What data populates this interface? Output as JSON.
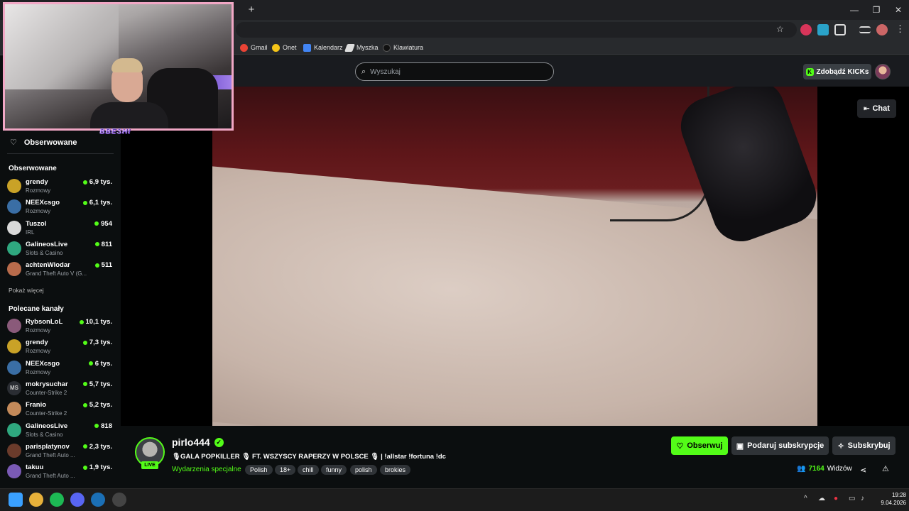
{
  "browser": {
    "new_tab": "+",
    "window_controls": {
      "minimize": "—",
      "restore": "❐",
      "close": "✕"
    },
    "bookmarks": [
      {
        "label": "Gmail",
        "icon": "gmail-icon",
        "color": "#ea4335"
      },
      {
        "label": "Onet",
        "icon": "onet-icon",
        "color": "#f5c518"
      },
      {
        "label": "Kalendarz",
        "icon": "calendar-icon",
        "color": "#4285f4"
      },
      {
        "label": "Myszka",
        "icon": "mouse-icon",
        "color": "#dddddd"
      },
      {
        "label": "Klawiatura",
        "icon": "keyboard-icon",
        "color": "#222222"
      }
    ]
  },
  "header": {
    "search_placeholder": "Wyszukaj",
    "kicks_button": "Zdobądź KICKs"
  },
  "overlay": {
    "logo_text": "BBESHI"
  },
  "sidebar": {
    "followed_header": "Obserwowane",
    "followed_title": "Obserwowane",
    "followed": [
      {
        "name": "grendy",
        "category": "Rozmowy",
        "viewers": "6,9 tys.",
        "color": "#c9a227"
      },
      {
        "name": "NEEXcsgo",
        "category": "Rozmowy",
        "viewers": "6,1 tys.",
        "color": "#3a6ea5"
      },
      {
        "name": "Tuszol",
        "category": "IRL",
        "viewers": "954",
        "color": "#d9d9d9"
      },
      {
        "name": "GalineosLive",
        "category": "Slots & Casino",
        "viewers": "811",
        "color": "#2fa87f"
      },
      {
        "name": "achtenWlodar",
        "category": "Grand Theft Auto V (G...",
        "viewers": "511",
        "color": "#b86b4b"
      }
    ],
    "show_more": "Pokaż więcej",
    "recommended_title": "Polecane kanały",
    "recommended": [
      {
        "name": "RybsonLoL",
        "category": "Rozmowy",
        "viewers": "10,1 tys.",
        "color": "#8a5a7a"
      },
      {
        "name": "grendy",
        "category": "Rozmowy",
        "viewers": "7,3 tys.",
        "color": "#c9a227"
      },
      {
        "name": "NEEXcsgo",
        "category": "Rozmowy",
        "viewers": "6 tys.",
        "color": "#3a6ea5"
      },
      {
        "name": "mokrysuchar",
        "category": "Counter-Strike 2",
        "viewers": "5,7 tys.",
        "color": "#2a2d33",
        "initials": "MS"
      },
      {
        "name": "Franio",
        "category": "Counter-Strike 2",
        "viewers": "5,2 tys.",
        "color": "#c48a5a"
      },
      {
        "name": "GalineosLive",
        "category": "Slots & Casino",
        "viewers": "818",
        "color": "#2fa87f"
      },
      {
        "name": "parisplatynov",
        "category": "Grand Theft Auto ...",
        "viewers": "2,3 tys.",
        "color": "#6b3b2b"
      },
      {
        "name": "takuu",
        "category": "Grand Theft Auto ...",
        "viewers": "1,9 tys.",
        "color": "#7a5ab5"
      }
    ]
  },
  "player": {
    "chat_button": "Chat"
  },
  "stream": {
    "name": "pirlo444",
    "live": "LIVE",
    "title": "🎙GALA POPKILLER 🎙 FT. WSZYSCY RAPERZY W POLSCE 🎙 | !allstar !fortuna !dc",
    "category": "Wydarzenia specjalne",
    "tags": [
      "Polish",
      "18+",
      "chill",
      "funny",
      "polish",
      "brokies"
    ],
    "follow_button": "Obserwuj",
    "gift_button": "Podaruj subskrypcje",
    "subscribe_button": "Subskrybuj",
    "viewers_count": "7164",
    "viewers_label": "Widzów"
  },
  "taskbar": {
    "time": "19:28",
    "date": "9.04.2026",
    "apps": [
      {
        "icon": "windows-start-icon",
        "color": "#3aa0ff"
      },
      {
        "icon": "chrome-icon",
        "color": "#e8b13a"
      },
      {
        "icon": "spotify-icon",
        "color": "#1db954"
      },
      {
        "icon": "discord-icon",
        "color": "#5865f2"
      },
      {
        "icon": "steam-icon",
        "color": "#1b6fb5"
      },
      {
        "icon": "obs-icon",
        "color": "#444444"
      }
    ]
  },
  "colors": {
    "accent": "#53fc18",
    "overlay_border": "#f1a7c5"
  }
}
